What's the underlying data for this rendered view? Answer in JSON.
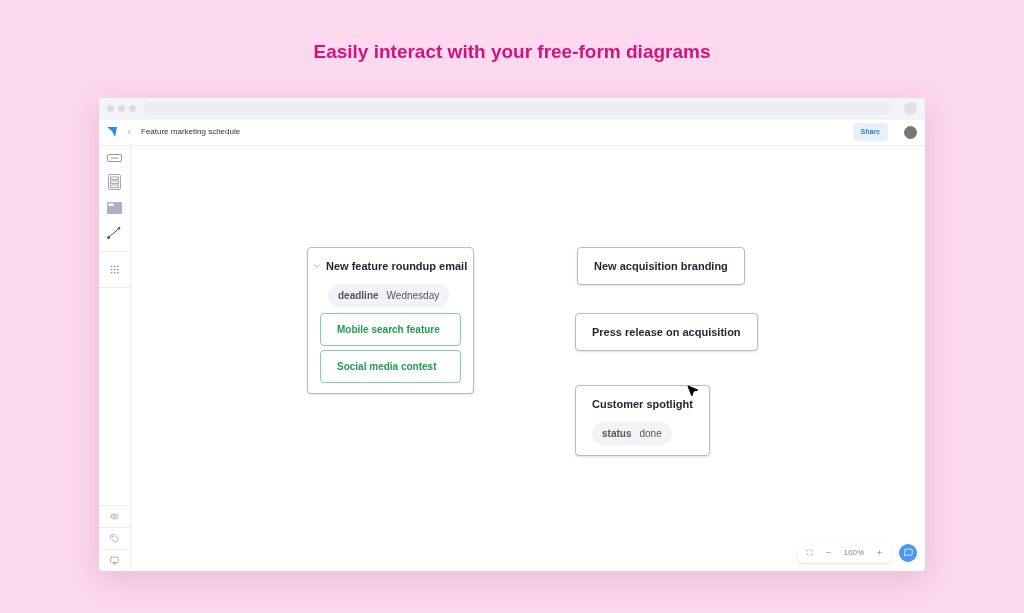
{
  "headline": "Easily interact with your free-form diagrams",
  "app": {
    "breadcrumb": "Feature marketing schedule",
    "share": "Share",
    "zoom": "100%"
  },
  "nodes": [
    {
      "kind": "group",
      "title": "New feature roundup email",
      "expanded": true,
      "tag": {
        "key": "deadline",
        "value": "Wednesday"
      },
      "children": [
        {
          "title": "Mobile search feature"
        },
        {
          "title": "Social media contest"
        }
      ]
    },
    {
      "kind": "card",
      "title": "New acquisition branding"
    },
    {
      "kind": "card",
      "title": "Press release on acquisition"
    },
    {
      "kind": "card",
      "title": "Customer spotlight",
      "tag": {
        "key": "status",
        "value": "done"
      }
    }
  ]
}
